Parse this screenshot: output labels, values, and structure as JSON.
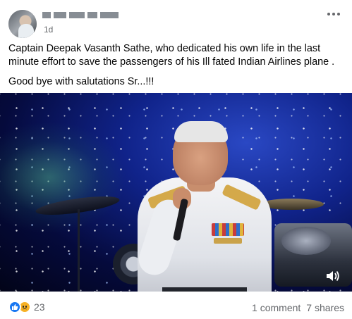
{
  "post": {
    "author_name": "",
    "timestamp": "1d",
    "text_paragraphs": [
      "Captain Deepak Vasanth Sathe, who dedicated his own life in the last minute effort to save the passengers of his Ill fated Indian Airlines plane .",
      "Good bye with salutations Sr...!!!"
    ],
    "media_icon": "volume-icon",
    "reactions": {
      "icons": [
        "like-icon",
        "sad-icon"
      ],
      "count": "23"
    },
    "comments_label": "1 comment",
    "shares_label": "7 shares"
  },
  "colors": {
    "like_blue": "#1877f2",
    "sad_yellow": "#f7b125",
    "meta_gray": "#65676b"
  }
}
